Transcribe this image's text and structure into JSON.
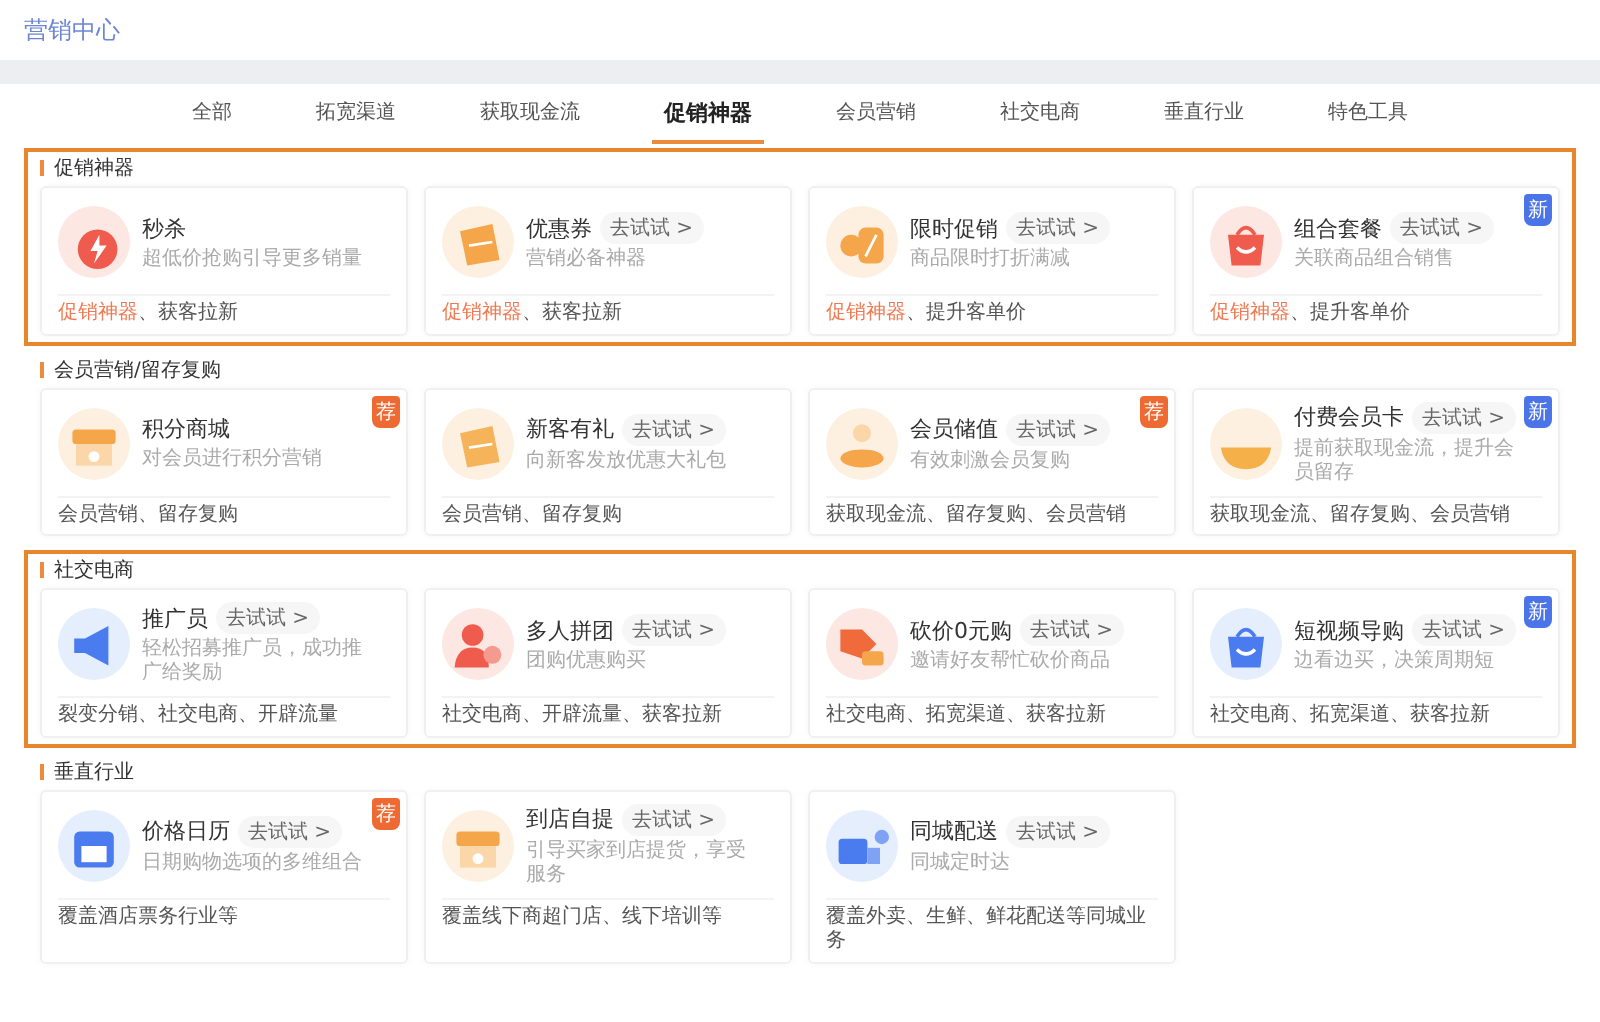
{
  "header": {
    "title": "营销中心"
  },
  "tabs": [
    {
      "label": "全部",
      "selected": false
    },
    {
      "label": "拓宽渠道",
      "selected": false
    },
    {
      "label": "获取现金流",
      "selected": false
    },
    {
      "label": "促销神器",
      "selected": true
    },
    {
      "label": "会员营销",
      "selected": false
    },
    {
      "label": "社交电商",
      "selected": false
    },
    {
      "label": "垂直行业",
      "selected": false
    },
    {
      "label": "特色工具",
      "selected": false
    }
  ],
  "sections": [
    {
      "title": "促销神器",
      "highlighted": true,
      "cards": [
        {
          "title": "秒杀",
          "subtitle": "超低价抢购引导更多销量",
          "tags": [
            {
              "text": "促销神器",
              "highlighted": true
            },
            {
              "text": "、获客拉新",
              "highlighted": false
            }
          ]
        },
        {
          "title": "优惠券",
          "try": "去试试 >",
          "subtitle": "营销必备神器",
          "tags": [
            {
              "text": "促销神器",
              "highlighted": true
            },
            {
              "text": "、获客拉新",
              "highlighted": false
            }
          ]
        },
        {
          "title": "限时促销",
          "try": "去试试 >",
          "subtitle": "商品限时打折满减",
          "tags": [
            {
              "text": "促销神器",
              "highlighted": true
            },
            {
              "text": "、提升客单价",
              "highlighted": false
            }
          ]
        },
        {
          "title": "组合套餐",
          "try": "去试试 >",
          "subtitle": "关联商品组合销售",
          "tags": [
            {
              "text": "促销神器",
              "highlighted": true
            },
            {
              "text": "、提升客单价",
              "highlighted": false
            }
          ],
          "badge": {
            "text": "新",
            "kind": "new"
          }
        }
      ]
    },
    {
      "title": "会员营销/留存复购",
      "highlighted": false,
      "cards": [
        {
          "title": "积分商城",
          "subtitle": "对会员进行积分营销",
          "tags": [
            {
              "text": "会员营销、留存复购",
              "highlighted": false
            }
          ],
          "badge": {
            "text": "荐",
            "kind": "recommend"
          }
        },
        {
          "title": "新客有礼",
          "try": "去试试 >",
          "subtitle": "向新客发放优惠大礼包",
          "tags": [
            {
              "text": "会员营销、留存复购",
              "highlighted": false
            }
          ]
        },
        {
          "title": "会员储值",
          "try": "去试试 >",
          "subtitle": "有效刺激会员复购",
          "tags": [
            {
              "text": "获取现金流、留存复购、会员营销",
              "highlighted": false
            }
          ],
          "badge": {
            "text": "荐",
            "kind": "recommend"
          }
        },
        {
          "title": "付费会员卡",
          "try": "去试试 >",
          "subtitle": "提前获取现金流，提升会员留存",
          "tags": [
            {
              "text": "获取现金流、留存复购、会员营销",
              "highlighted": false
            }
          ],
          "badge": {
            "text": "新",
            "kind": "new"
          }
        }
      ]
    },
    {
      "title": "社交电商",
      "highlighted": true,
      "cards": [
        {
          "title": "推广员",
          "try": "去试试 >",
          "subtitle": "轻松招募推广员，成功推广给奖励",
          "tags": [
            {
              "text": "裂变分销、社交电商、开辟流量",
              "highlighted": false
            }
          ]
        },
        {
          "title": "多人拼团",
          "try": "去试试 >",
          "subtitle": "团购优惠购买",
          "tags": [
            {
              "text": "社交电商、开辟流量、获客拉新",
              "highlighted": false
            }
          ]
        },
        {
          "title": "砍价0元购",
          "try": "去试试 >",
          "subtitle": "邀请好友帮忙砍价商品",
          "tags": [
            {
              "text": "社交电商、拓宽渠道、获客拉新",
              "highlighted": false
            }
          ]
        },
        {
          "title": "短视频导购",
          "try": "去试试 >",
          "subtitle": "边看边买，决策周期短",
          "tags": [
            {
              "text": "社交电商、拓宽渠道、获客拉新",
              "highlighted": false
            }
          ],
          "badge": {
            "text": "新",
            "kind": "new"
          }
        }
      ]
    },
    {
      "title": "垂直行业",
      "highlighted": false,
      "cards": [
        {
          "title": "价格日历",
          "try": "去试试 >",
          "subtitle": "日期购物选项的多维组合",
          "tags": [
            {
              "text": "覆盖酒店票务行业等",
              "highlighted": false
            }
          ],
          "badge": {
            "text": "荐",
            "kind": "recommend"
          }
        },
        {
          "title": "到店自提",
          "try": "去试试 >",
          "subtitle": "引导买家到店提货，享受服务",
          "tags": [
            {
              "text": "覆盖线下商超门店、线下培训等",
              "highlighted": false
            }
          ]
        },
        {
          "title": "同城配送",
          "try": "去试试 >",
          "subtitle": "同城定时达",
          "tags": [
            {
              "text": "覆盖外卖、生鲜、鲜花配送等同城业务",
              "highlighted": false
            }
          ]
        }
      ]
    }
  ]
}
